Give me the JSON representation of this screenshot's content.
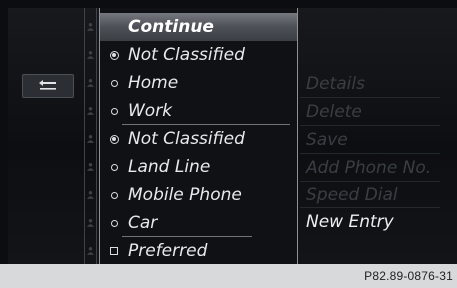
{
  "menu": {
    "items": [
      {
        "label": "Continue",
        "mark": "none",
        "selected": true
      },
      {
        "label": "Not Classified",
        "mark": "radio-on"
      },
      {
        "label": "Home",
        "mark": "radio-off"
      },
      {
        "label": "Work",
        "mark": "radio-off"
      },
      {
        "label": "Not Classified",
        "mark": "radio-on"
      },
      {
        "label": "Land Line",
        "mark": "radio-off"
      },
      {
        "label": "Mobile Phone",
        "mark": "radio-off"
      },
      {
        "label": "Car",
        "mark": "radio-off"
      },
      {
        "label": "Preferred",
        "mark": "checkbox"
      }
    ]
  },
  "right_menu": {
    "items": [
      {
        "label": "Details",
        "enabled": false
      },
      {
        "label": "Delete",
        "enabled": false
      },
      {
        "label": "Save",
        "enabled": false
      },
      {
        "label": "Add Phone No.",
        "enabled": false
      },
      {
        "label": "Speed Dial",
        "enabled": false
      },
      {
        "label": "New Entry",
        "enabled": true
      }
    ]
  },
  "back_button": {
    "icon": "back-arrow-icon"
  },
  "footer": {
    "code": "P82.89-0876-31"
  },
  "colors": {
    "selected_bar": "#5c6066",
    "disabled_text": "#3a3e44",
    "active_text": "#eeeeee",
    "background": "#0d0e11"
  }
}
